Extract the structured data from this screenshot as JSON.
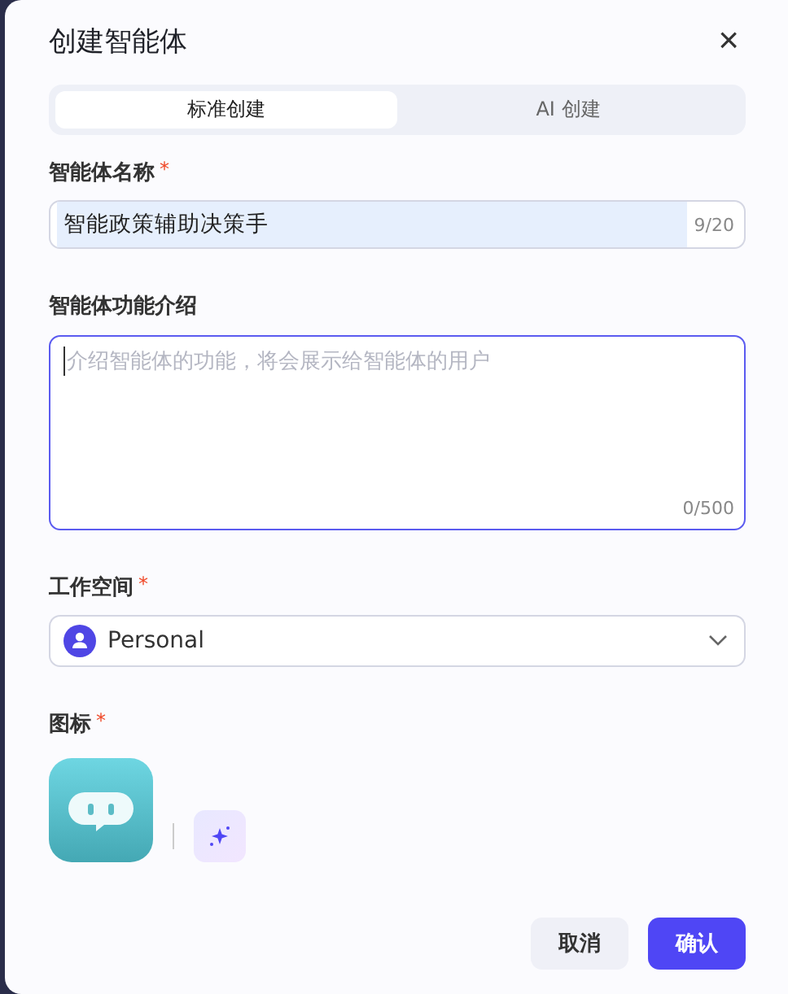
{
  "dialog": {
    "title": "创建智能体",
    "close": "×"
  },
  "tabs": [
    {
      "label": "标准创建",
      "selected": true
    },
    {
      "label": "AI 创建",
      "selected": false
    }
  ],
  "name_field": {
    "label": "智能体名称",
    "required_mark": "*",
    "value": "智能政策辅助决策手",
    "count": "9/20"
  },
  "description_field": {
    "label": "智能体功能介绍",
    "placeholder": "介绍智能体的功能，将会展示给智能体的用户",
    "count": "0/500"
  },
  "workspace_field": {
    "label": "工作空间",
    "required_mark": "*",
    "value": "Personal"
  },
  "icon_field": {
    "label": "图标",
    "required_mark": "*"
  },
  "buttons": [
    {
      "label": "取消",
      "kind": "secondary"
    },
    {
      "label": "确认",
      "kind": "primary"
    }
  ]
}
